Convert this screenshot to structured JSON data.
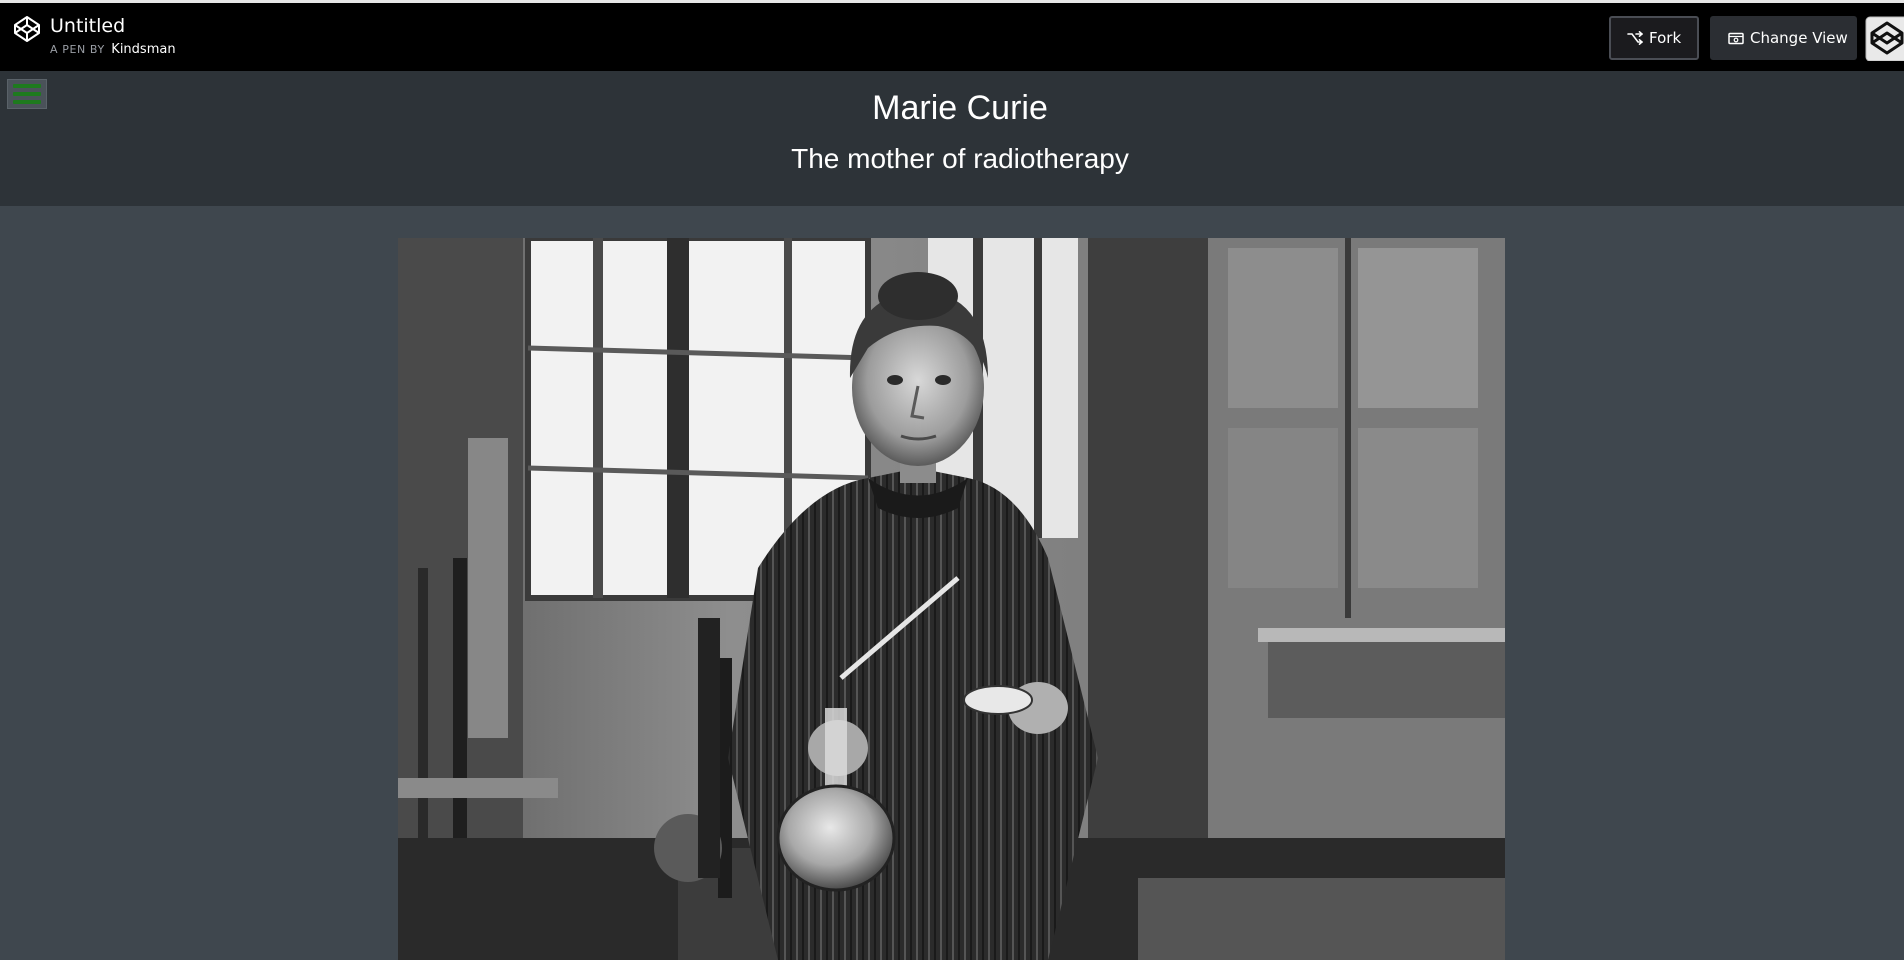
{
  "codepen_bar": {
    "logo_icon": "codepen-logo-icon",
    "pen_title": "Untitled",
    "pen_by_prefix": "A PEN BY",
    "pen_author": "Kindsman",
    "fork_label": "Fork",
    "fork_icon": "fork-icon",
    "change_view_label": "Change View",
    "change_view_icon": "change-view-icon",
    "corner_icon": "codepen-corner-icon"
  },
  "pen": {
    "nav_toggle_icon": "hamburger-menu-icon",
    "title": "Marie Curie",
    "subtitle": "The mother of radiotherapy",
    "image_subject": "marie-curie-photograph"
  },
  "colors": {
    "topbar": "#000000",
    "header_bg": "#2d3338",
    "page_bg": "#3f474e",
    "hamburger": "#1e7a1e"
  }
}
